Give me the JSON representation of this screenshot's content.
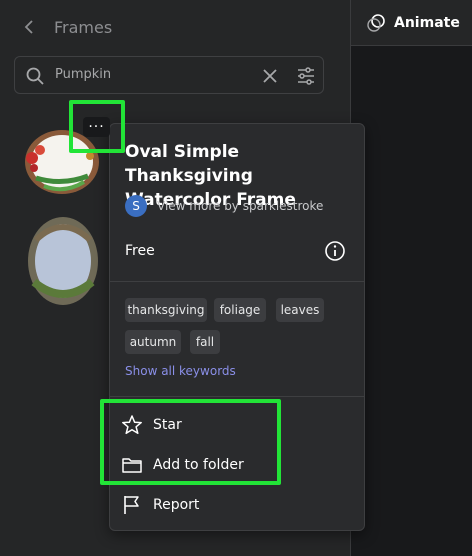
{
  "header": {
    "title": "Frames",
    "back_icon": "chevron-left-icon"
  },
  "search": {
    "value": "Pumpkin",
    "search_icon": "search-icon",
    "clear_icon": "close-icon",
    "filter_icon": "filter-sliders-icon"
  },
  "animate": {
    "label": "Animate",
    "icon": "animate-circles-icon"
  },
  "more_button": {
    "label": "···"
  },
  "popover": {
    "title": "Oval Simple Thanksgiving Watercolor Frame",
    "author": {
      "avatar_letter": "S",
      "text": "View more by sparklestroke"
    },
    "price": "Free",
    "info_icon": "info-icon",
    "tags": [
      "thanksgiving",
      "foliage",
      "leaves",
      "autumn",
      "fall"
    ],
    "show_all": "Show all keywords",
    "actions": [
      {
        "label": "Star",
        "icon": "star-icon"
      },
      {
        "label": "Add to folder",
        "icon": "folder-icon"
      },
      {
        "label": "Report",
        "icon": "flag-icon"
      }
    ]
  },
  "colors": {
    "highlight": "#22e437",
    "panel": "#252627",
    "popover": "#2a2b2d",
    "link": "#8a8fe8"
  }
}
